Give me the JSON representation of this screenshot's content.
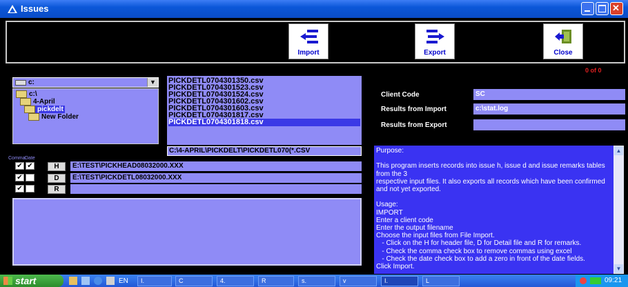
{
  "window": {
    "title": "Issues",
    "title_color": "#0a4cc7"
  },
  "toolbar": {
    "import_label": "Import",
    "export_label": "Export",
    "close_label": "Close"
  },
  "counter": "0 of 0",
  "drive": {
    "value": "c:"
  },
  "tree": {
    "items": [
      "c:\\",
      "4-April",
      "pickdelt",
      "New Folder"
    ]
  },
  "files": {
    "items": [
      "PICKDETL0704301350.csv",
      "PICKDETL0704301523.csv",
      "PICKDETL0704301524.csv",
      "PICKDETL0704301602.csv",
      "PICKDETL0704301603.csv",
      "PICKDETL0704301817.csv",
      "PICKDETL0704301818.csv"
    ],
    "selected": "PICKDETL0704301818.csv"
  },
  "path": "C:\\4-APRIL\\PICKDELT\\PICKDETL070(*.CSV",
  "options": {
    "comma_header": "Comma",
    "date_header": "Date",
    "rows": [
      {
        "button": "H",
        "path": "E:\\TEST\\PICKHEAD08032000.XXX"
      },
      {
        "button": "D",
        "path": "E:\\TEST\\PICKDETL08032000.XXX"
      },
      {
        "button": "R",
        "path": ""
      }
    ]
  },
  "form": {
    "client_code_label": "Client Code",
    "client_code_value": "SC",
    "results_import_label": "Results from Import",
    "results_import_value": "c:\\stat.log",
    "results_export_label": "Results from Export",
    "results_export_value": ""
  },
  "help": {
    "text": "Purpose:\n\nThis program inserts records into issue h, issue d and issue remarks tables from the 3\nrespective input files. It also exports all records which have been confirmed and not yet exported.\n\nUsage:\nIMPORT\nEnter a client code\nEnter the output filename\nChoose the input files from File Import.\n   - Click on the H for header file, D for Detail file and R for remarks.\n   - Check the comma check box to remove commas using excel\n   - Check the date check box to add a zero in front of the date fields.\nClick Import.\n\nEXPORT"
  },
  "taskbar": {
    "start_label": "start",
    "lang": "EN",
    "tasks": [
      "I.",
      "C",
      "4.",
      "R",
      "s.",
      "v",
      "I.",
      "L"
    ],
    "clock": "09:21"
  }
}
